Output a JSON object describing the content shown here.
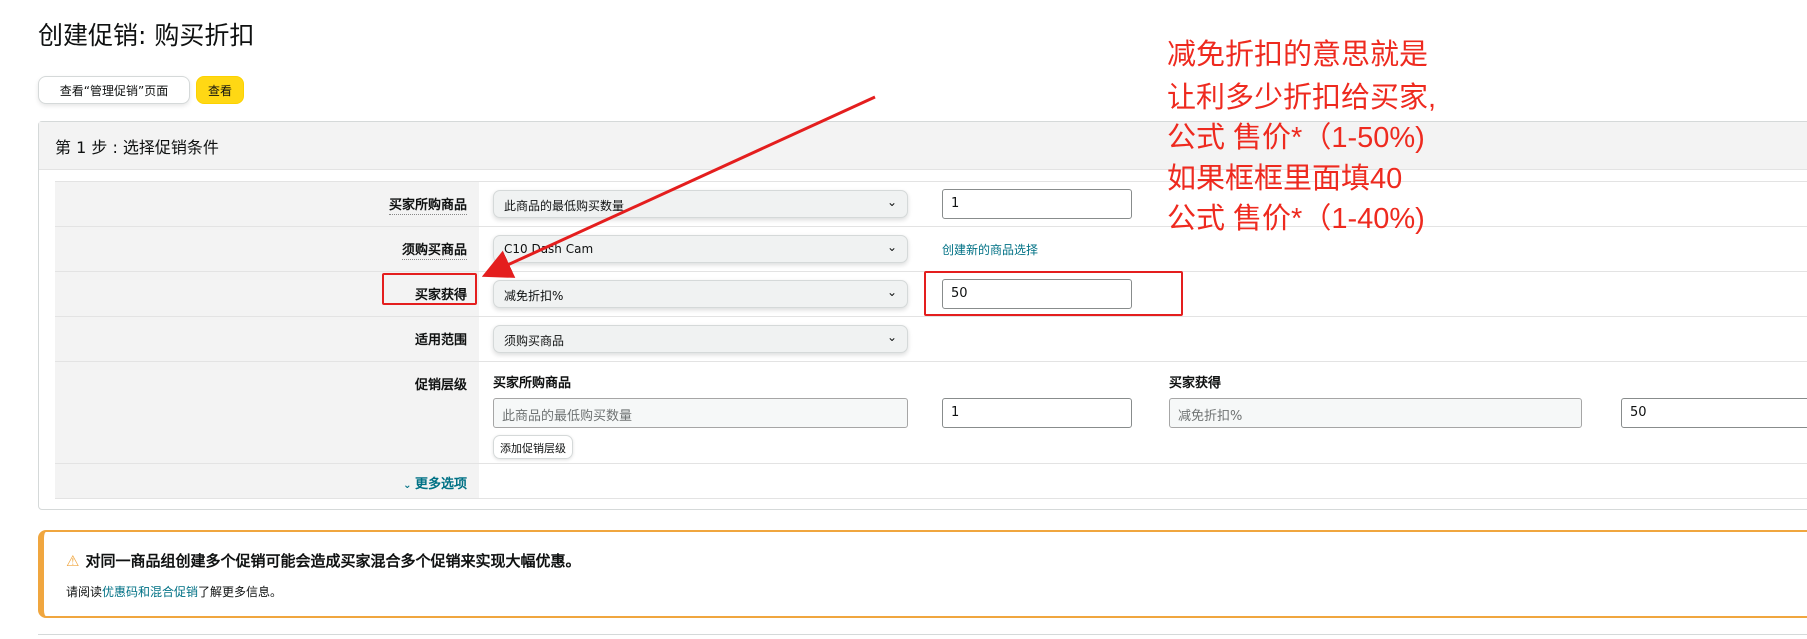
{
  "page": {
    "title": "创建促销: 购买折扣"
  },
  "toolbar": {
    "manage_label": "查看“管理促销”页面",
    "view_label": "查看",
    "view_color": "#ffd814"
  },
  "step1": {
    "header": "第 1 步 : 选择促销条件",
    "rows": [
      {
        "label": "买家所购商品",
        "select": "此商品的最低购买数量",
        "input": "1"
      },
      {
        "label": "须购买商品",
        "select": "C10 Dash Cam",
        "link": "创建新的商品选择"
      },
      {
        "label": "买家获得",
        "select": "减免折扣%",
        "input": "50"
      },
      {
        "label": "适用范围",
        "select": "须购买商品"
      }
    ],
    "tiers": {
      "label": "促销层级",
      "buyer_purchases_header": "买家所购商品",
      "buyer_purchases_field": "此商品的最低购买数量",
      "buyer_purchases_value": "1",
      "buyer_gets_header": "买家获得",
      "buyer_gets_field": "减免折扣%",
      "buyer_gets_value": "50",
      "add_tier_label": "添加促销层级"
    },
    "more_options": "更多选项"
  },
  "warning": {
    "title": "对同一商品组创建多个促销可能会造成买家混合多个促销来实现大幅优惠。",
    "prefix": "请阅读",
    "link": "优惠码和混合促销",
    "suffix": "了解更多信息。"
  },
  "annotation": {
    "color": "#ee2a1f",
    "lines": [
      "减免折扣的意思就是",
      "让利多少折扣给买家,",
      "公式 售价*（1-50%)",
      "如果框框里面填40",
      "公式 售价*（1-40%)"
    ]
  }
}
